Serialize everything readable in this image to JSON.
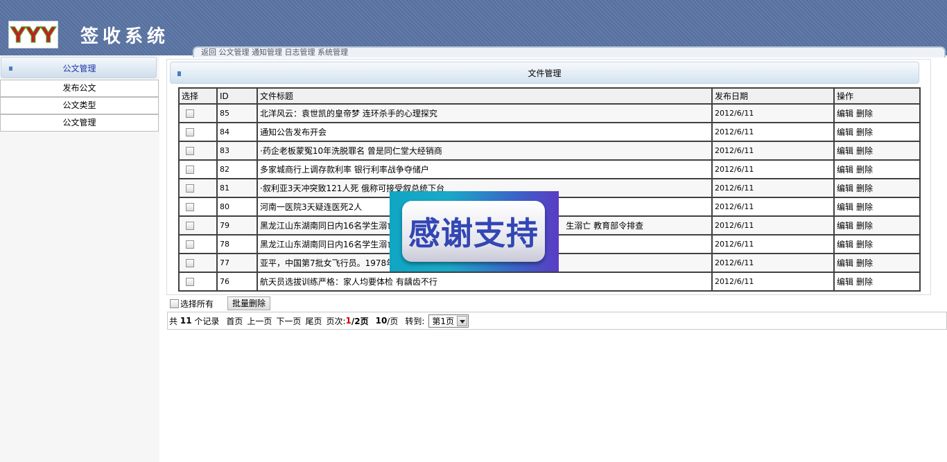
{
  "header": {
    "title": "签收系统",
    "logo_text": "YYY",
    "top_nav": "返回  公文管理  通知管理  日志管理  系统管理"
  },
  "sidebar": {
    "title": "公文管理",
    "items": [
      {
        "label": "发布公文"
      },
      {
        "label": "公文类型"
      },
      {
        "label": "公文管理"
      }
    ]
  },
  "panel": {
    "title": "文件管理"
  },
  "table": {
    "columns": [
      "选择",
      "ID",
      "文件标题",
      "发布日期",
      "操作"
    ],
    "edit_label": "编辑",
    "delete_label": "删除",
    "rows": [
      {
        "id": "85",
        "title": "北洋风云：袁世凯的皇帝梦 连环杀手的心理探究",
        "date": "2012/6/11"
      },
      {
        "id": "84",
        "title": "通知公告发布开会",
        "date": "2012/6/11"
      },
      {
        "id": "83",
        "title": "·药企老板蒙冤10年洗脱罪名 曾是同仁堂大经销商",
        "date": "2012/6/11"
      },
      {
        "id": "82",
        "title": "多家城商行上调存款利率 银行利率战争夺储户",
        "date": "2012/6/11"
      },
      {
        "id": "81",
        "title": "·叙利亚3天冲突致121人死 俄称可接受叙总统下台",
        "date": "2012/6/11"
      },
      {
        "id": "80",
        "title": "河南一医院3天疑连医死2人",
        "date": "2012/6/11"
      },
      {
        "id": "79",
        "title": "黑龙江山东湖南同日内16名学生溺亡",
        "title_tail": "生溺亡 教育部令排查",
        "date": "2012/6/11"
      },
      {
        "id": "78",
        "title": "黑龙江山东湖南同日内16名学生溺亡",
        "date": "2012/6/11"
      },
      {
        "id": "77",
        "title": "亚平，中国第7批女飞行员。1978年",
        "date": "2012/6/11"
      },
      {
        "id": "76",
        "title": "航天员选拔训练严格：家人均要体检 有龋齿不行",
        "date": "2012/6/11"
      }
    ]
  },
  "bottom": {
    "select_all_label": "选择所有",
    "batch_delete_label": "批量删除"
  },
  "pager": {
    "prefix": "共",
    "total": "11",
    "suffix": "个记录",
    "first": "首页",
    "prev": "上一页",
    "next": "下一页",
    "last": "尾页",
    "page_label": "页次:",
    "current_page": "1",
    "total_pages": "/2页",
    "per_page": "10",
    "per_page_suffix": "/页",
    "goto_label": "转到:",
    "goto_value": "第1页"
  },
  "overlay": {
    "text": "感谢支持"
  },
  "colors": {
    "header_bg": "#5a74a3",
    "sidebar_title": "#1d36a5",
    "current_page": "#d00000"
  }
}
